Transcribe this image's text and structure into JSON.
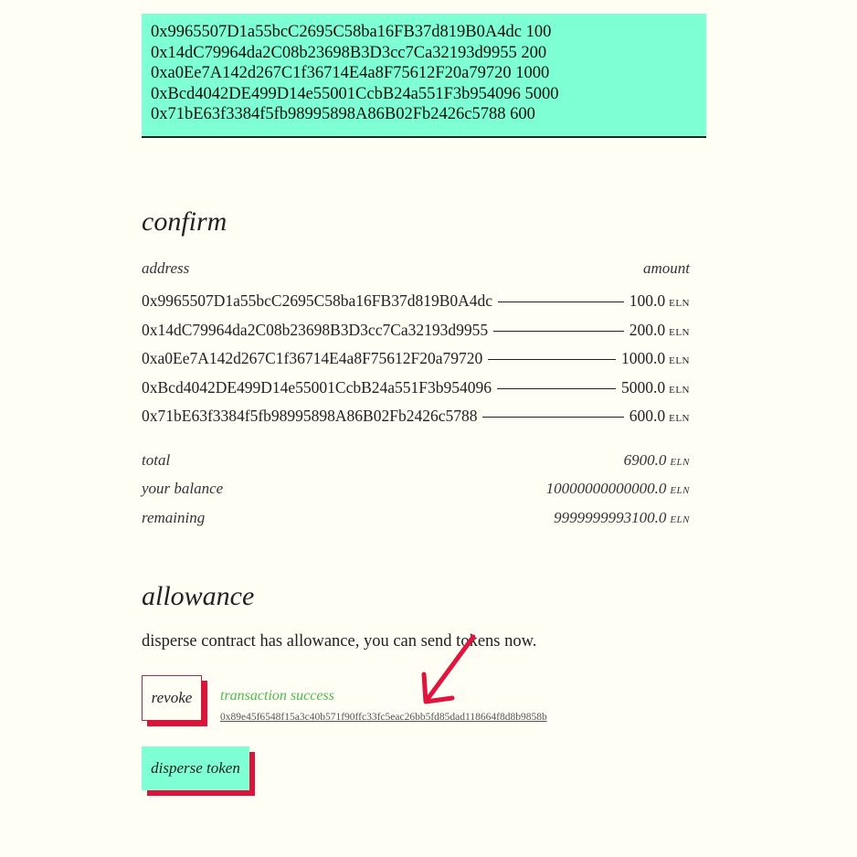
{
  "recipients_input": {
    "value": "0x9965507D1a55bcC2695C58ba16FB37d819B0A4dc 100\n0x14dC79964da2C08b23698B3D3cc7Ca32193d9955 200\n0xa0Ee7A142d267C1f36714E4a8F75612F20a79720 1000\n0xBcd4042DE499D14e55001CcbB24a551F3b954096 5000\n0x71bE63f3384f5fb98995898A86B02Fb2426c5788 600"
  },
  "confirm": {
    "title": "confirm",
    "header": {
      "address": "address",
      "amount": "amount"
    },
    "entries": [
      {
        "address": "0x9965507D1a55bcC2695C58ba16FB37d819B0A4dc",
        "amount": "100.0",
        "unit": "ELN"
      },
      {
        "address": "0x14dC79964da2C08b23698B3D3cc7Ca32193d9955",
        "amount": "200.0",
        "unit": "ELN"
      },
      {
        "address": "0xa0Ee7A142d267C1f36714E4a8F75612F20a79720",
        "amount": "1000.0",
        "unit": "ELN"
      },
      {
        "address": "0xBcd4042DE499D14e55001CcbB24a551F3b954096",
        "amount": "5000.0",
        "unit": "ELN"
      },
      {
        "address": "0x71bE63f3384f5fb98995898A86B02Fb2426c5788",
        "amount": "600.0",
        "unit": "ELN"
      }
    ],
    "summary": {
      "total_label": "total",
      "total_value": "6900.0",
      "balance_label": "your balance",
      "balance_value": "10000000000000.0",
      "remaining_label": "remaining",
      "remaining_value": "9999999993100.0",
      "unit": "ELN"
    }
  },
  "allowance": {
    "title": "allowance",
    "message": "disperse contract has allowance, you can send tokens now.",
    "revoke_label": "revoke",
    "tx_status": "transaction success",
    "tx_hash": "0x89e45f6548f15a3c40b571f90ffc33fc5eac26bb5fd85dad118664f8d8b9858b",
    "disperse_label": "disperse token"
  },
  "colors": {
    "background": "#fffef5",
    "accent": "#7fffd4",
    "shadow": "#dc143c",
    "success": "#4cbb4c",
    "arrow": "#e0143c"
  },
  "icons": {
    "annotation": "arrow-icon"
  }
}
